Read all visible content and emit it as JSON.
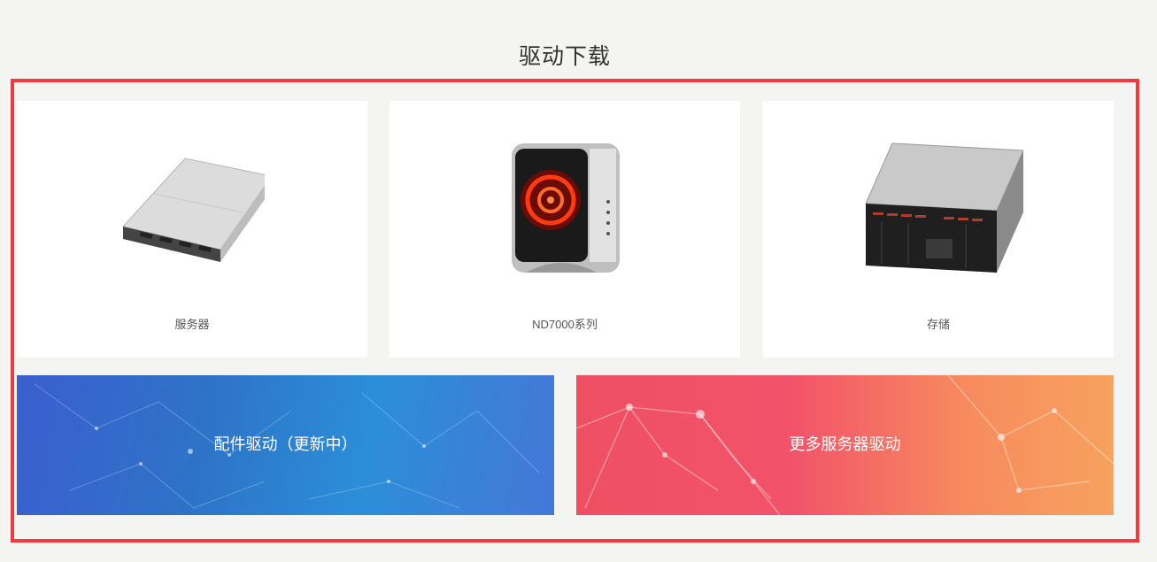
{
  "section_title": "驱动下载",
  "cards": [
    {
      "label": "服务器",
      "icon": "rack-server-icon"
    },
    {
      "label": "ND7000系列",
      "icon": "tower-workstation-icon"
    },
    {
      "label": "存储",
      "icon": "storage-chassis-icon"
    }
  ],
  "banners": [
    {
      "label": "配件驱动（更新中）",
      "color": "#2e73c8"
    },
    {
      "label": "更多服务器驱动",
      "color": "#f2536a"
    }
  ],
  "colors": {
    "frame": "#ef3a3f",
    "background": "#f4f4f3"
  }
}
